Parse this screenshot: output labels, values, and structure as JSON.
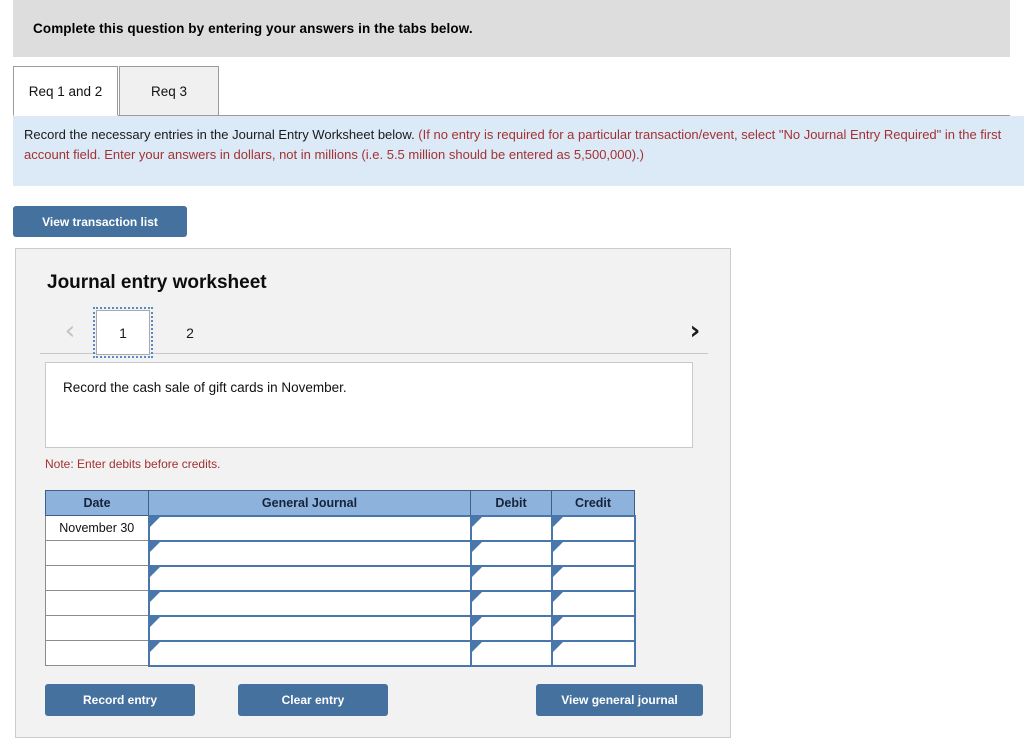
{
  "banner": {
    "text": "Complete this question by entering your answers in the tabs below."
  },
  "tabs": [
    {
      "label": "Req 1 and 2",
      "active": true
    },
    {
      "label": "Req 3",
      "active": false
    }
  ],
  "instruction": {
    "black_part": "Record the necessary entries in the Journal Entry Worksheet below. ",
    "red_part": "(If no entry is required for a particular transaction/event, select \"No Journal Entry Required\" in the first account field. Enter your answers in dollars, not in millions (i.e. 5.5 million should be entered as 5,500,000).)"
  },
  "toolbar": {
    "view_transaction_list_label": "View transaction list"
  },
  "worksheet": {
    "title": "Journal entry worksheet",
    "pager": {
      "prev_icon": "chevron-left-icon",
      "next_icon": "chevron-right-icon",
      "pages": [
        {
          "label": "1",
          "selected": true
        },
        {
          "label": "2",
          "selected": false
        }
      ]
    },
    "prompt": "Record the cash sale of gift cards in November.",
    "note": "Note: Enter debits before credits.",
    "table": {
      "headers": [
        "Date",
        "General Journal",
        "Debit",
        "Credit"
      ],
      "rows": [
        {
          "date": "November 30",
          "general_journal": "",
          "debit": "",
          "credit": ""
        },
        {
          "date": "",
          "general_journal": "",
          "debit": "",
          "credit": ""
        },
        {
          "date": "",
          "general_journal": "",
          "debit": "",
          "credit": ""
        },
        {
          "date": "",
          "general_journal": "",
          "debit": "",
          "credit": ""
        },
        {
          "date": "",
          "general_journal": "",
          "debit": "",
          "credit": ""
        },
        {
          "date": "",
          "general_journal": "",
          "debit": "",
          "credit": ""
        }
      ]
    },
    "buttons": {
      "record_entry": "Record entry",
      "clear_entry": "Clear entry",
      "view_general_journal": "View general journal"
    }
  },
  "colors": {
    "button_blue": "#44719e",
    "table_header_blue": "#8db3dd",
    "instruction_bg": "#dce9f7",
    "instruction_red": "#a33232",
    "banner_gray": "#dddddd"
  }
}
